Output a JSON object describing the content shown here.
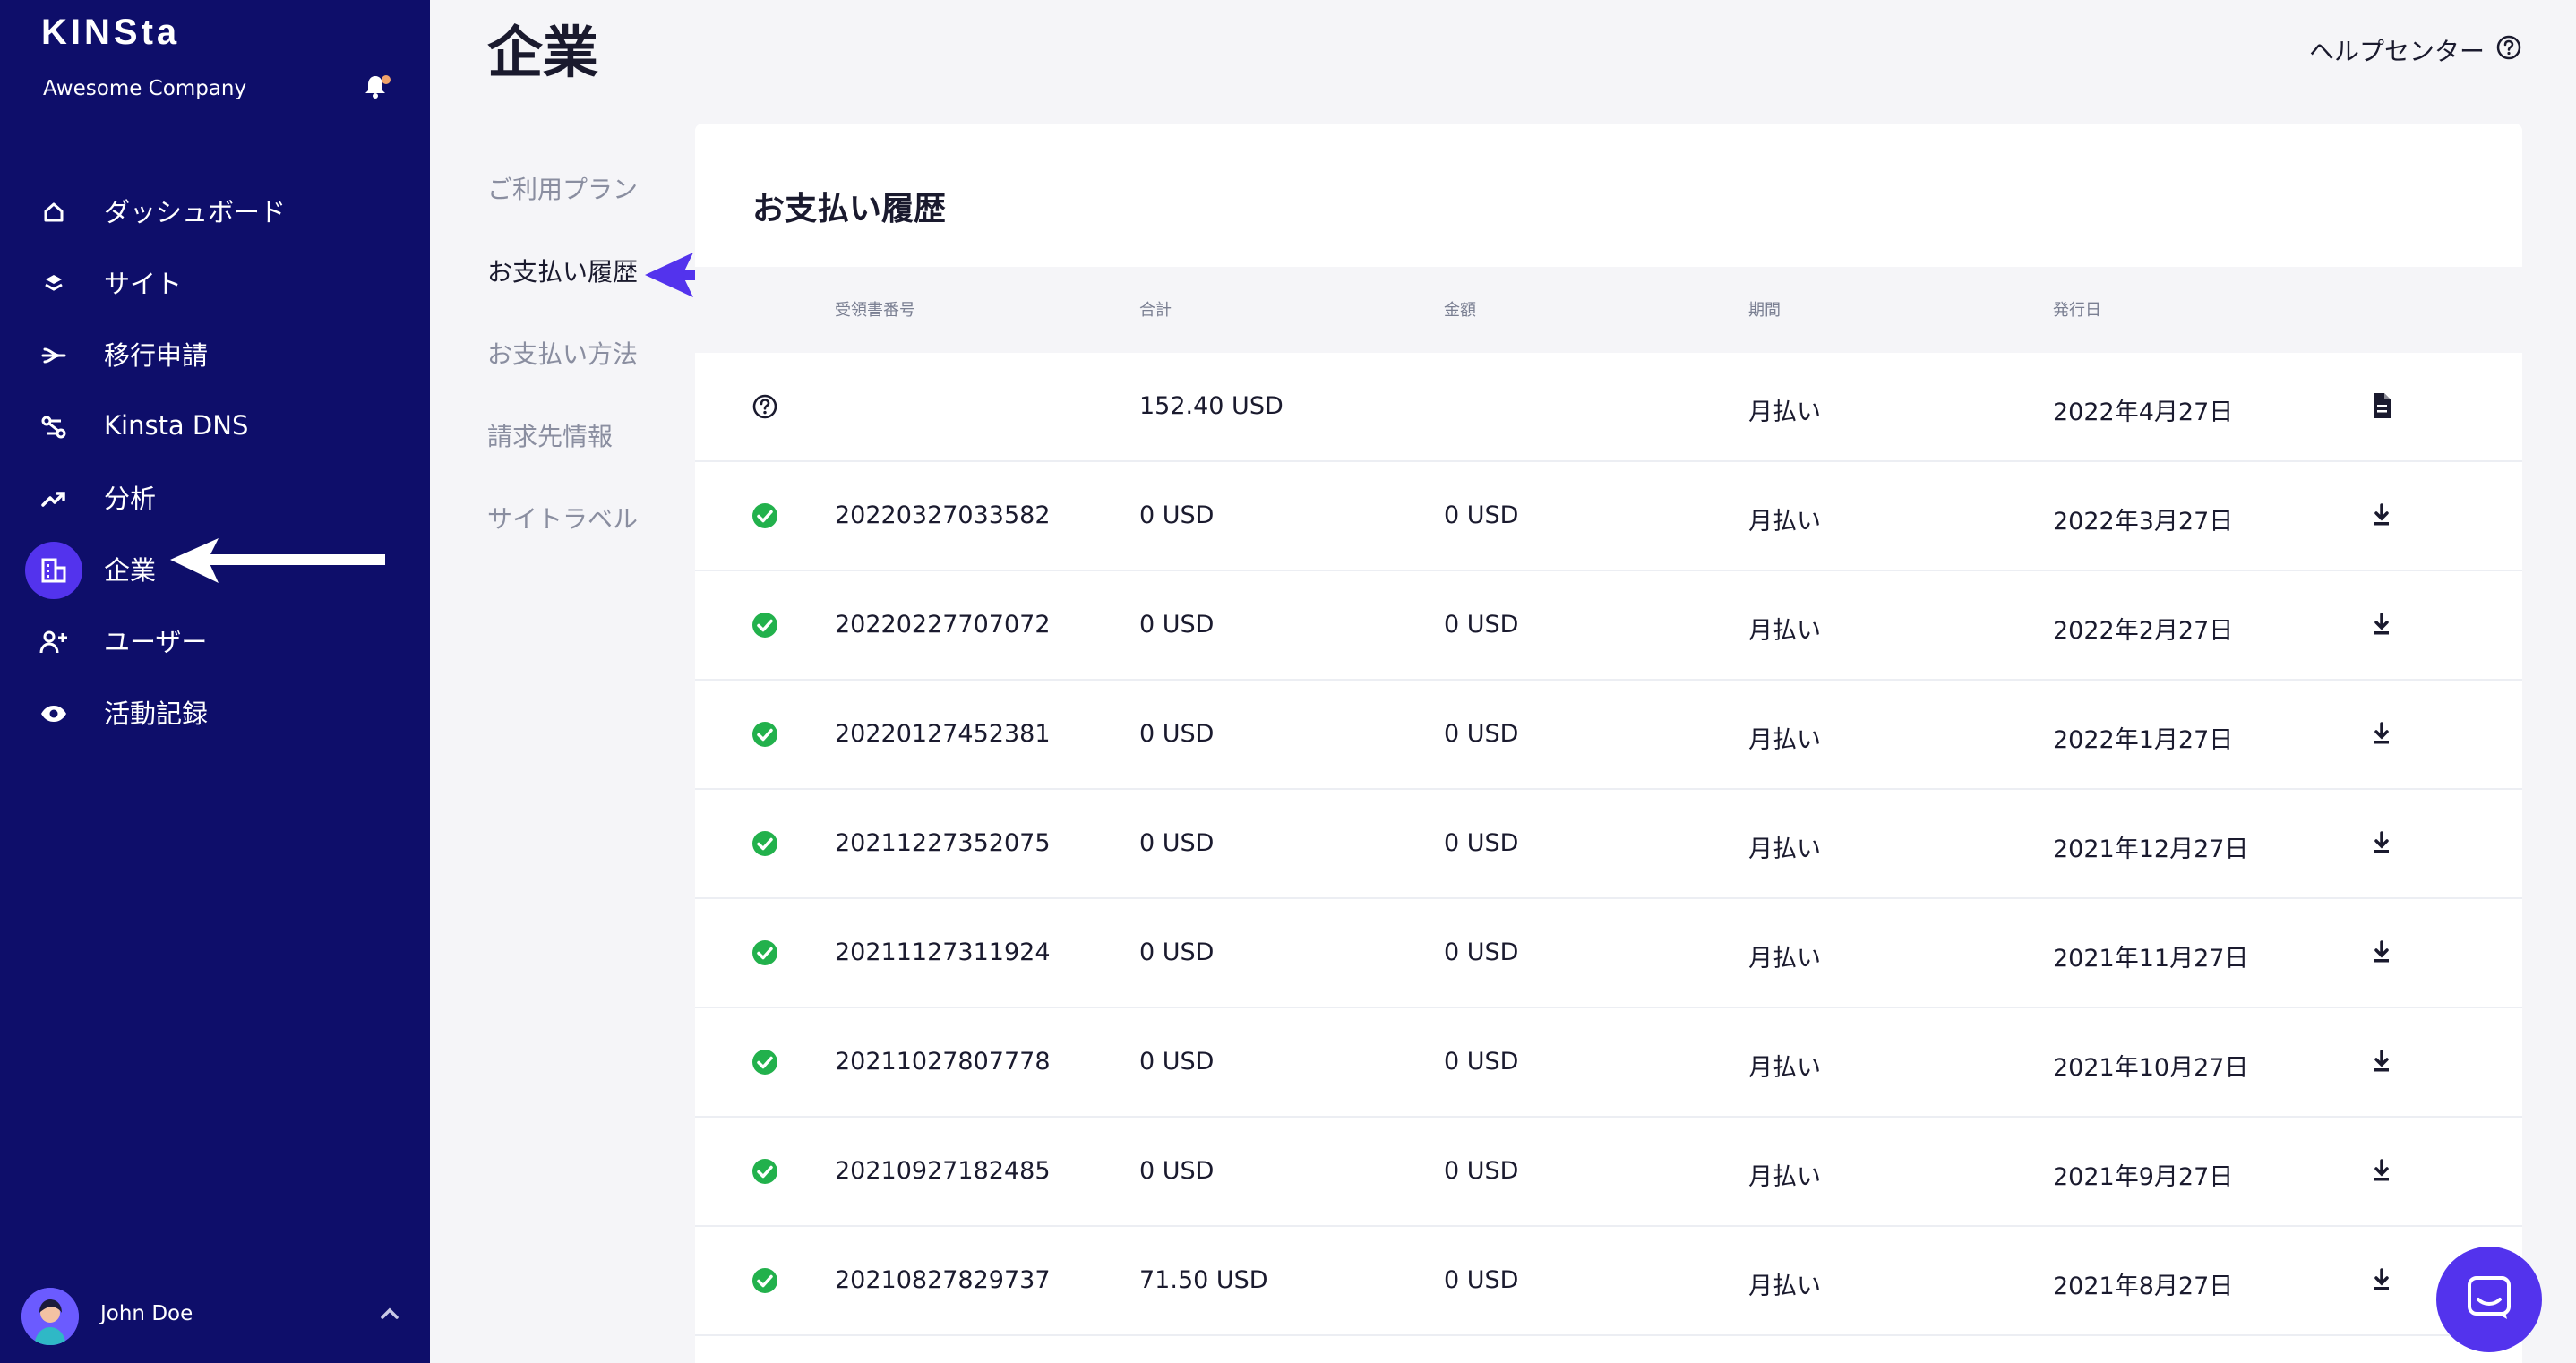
{
  "sidebar": {
    "logo": "KINSta",
    "company": "Awesome Company",
    "items": [
      {
        "label": "ダッシュボード",
        "icon": "home-icon"
      },
      {
        "label": "サイト",
        "icon": "layers-icon"
      },
      {
        "label": "移行申請",
        "icon": "migration-icon"
      },
      {
        "label": "Kinsta DNS",
        "icon": "dns-icon"
      },
      {
        "label": "分析",
        "icon": "analytics-icon"
      },
      {
        "label": "企業",
        "icon": "building-icon",
        "active": true
      },
      {
        "label": "ユーザー",
        "icon": "add-user-icon"
      },
      {
        "label": "活動記録",
        "icon": "eye-icon"
      }
    ],
    "user_name": "John Doe"
  },
  "header": {
    "title": "企業",
    "help": "ヘルプセンター"
  },
  "subnav": {
    "items": [
      "ご利用プラン",
      "お支払い履歴",
      "お支払い方法",
      "請求先情報",
      "サイトラベル"
    ],
    "active_index": 1
  },
  "billing": {
    "title": "お支払い履歴",
    "columns": [
      "受領書番号",
      "合計",
      "金額",
      "期間",
      "発行日"
    ],
    "rows": [
      {
        "status": "pending",
        "number": "",
        "total": "152.40 USD",
        "amount": "",
        "period": "月払い",
        "date": "2022年4月27日",
        "action": "document"
      },
      {
        "status": "paid",
        "number": "20220327033582",
        "total": "0 USD",
        "amount": "0 USD",
        "period": "月払い",
        "date": "2022年3月27日",
        "action": "download"
      },
      {
        "status": "paid",
        "number": "20220227707072",
        "total": "0 USD",
        "amount": "0 USD",
        "period": "月払い",
        "date": "2022年2月27日",
        "action": "download"
      },
      {
        "status": "paid",
        "number": "20220127452381",
        "total": "0 USD",
        "amount": "0 USD",
        "period": "月払い",
        "date": "2022年1月27日",
        "action": "download"
      },
      {
        "status": "paid",
        "number": "20211227352075",
        "total": "0 USD",
        "amount": "0 USD",
        "period": "月払い",
        "date": "2021年12月27日",
        "action": "download"
      },
      {
        "status": "paid",
        "number": "20211127311924",
        "total": "0 USD",
        "amount": "0 USD",
        "period": "月払い",
        "date": "2021年11月27日",
        "action": "download"
      },
      {
        "status": "paid",
        "number": "20211027807778",
        "total": "0 USD",
        "amount": "0 USD",
        "period": "月払い",
        "date": "2021年10月27日",
        "action": "download"
      },
      {
        "status": "paid",
        "number": "20210927182485",
        "total": "0 USD",
        "amount": "0 USD",
        "period": "月払い",
        "date": "2021年9月27日",
        "action": "download"
      },
      {
        "status": "paid",
        "number": "20210827829737",
        "total": "71.50 USD",
        "amount": "0 USD",
        "period": "月払い",
        "date": "2021年8月27日",
        "action": "download"
      }
    ]
  },
  "colors": {
    "sidebar_bg": "#0e0e6a",
    "accent": "#5333ed",
    "success": "#22b14c"
  }
}
